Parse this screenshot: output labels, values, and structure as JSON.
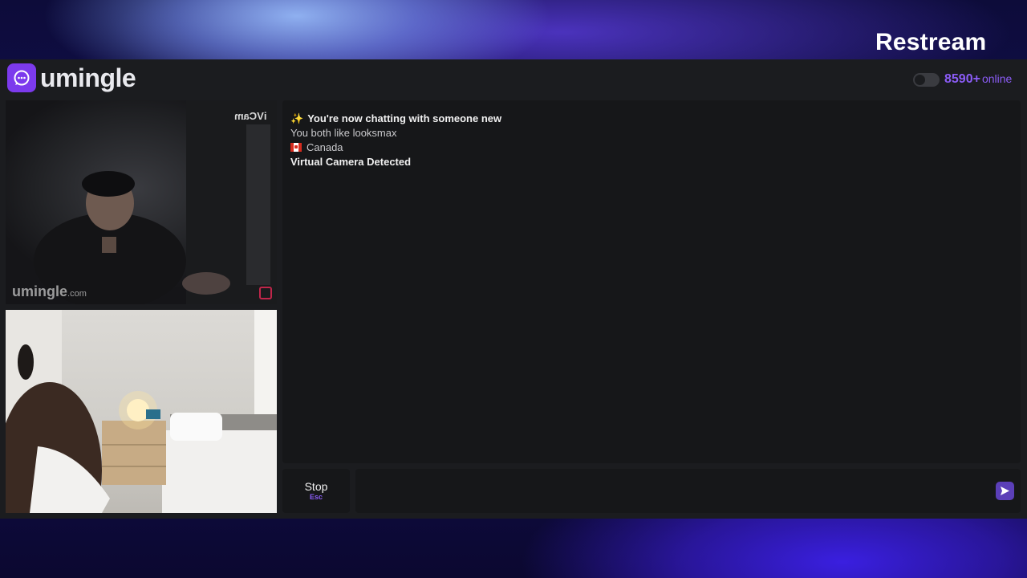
{
  "overlay": {
    "brand": "Restream"
  },
  "header": {
    "logo_text": "umingle",
    "online_count": "8590+",
    "online_label": "online",
    "theme_toggle_on": false
  },
  "remote_video": {
    "camera_badge": "iVCam",
    "watermark_main": "umingle",
    "watermark_suffix": ".com"
  },
  "chat": {
    "messages": [
      {
        "icon": "sparkle-icon",
        "text": "You're now chatting with someone new"
      },
      {
        "text": "You both like looksmax"
      },
      {
        "icon": "canada-flag-icon",
        "text": "Canada"
      },
      {
        "text": "Virtual Camera Detected"
      }
    ]
  },
  "controls": {
    "stop_label": "Stop",
    "stop_shortcut": "Esc",
    "message_value": "",
    "send_icon": "send-icon"
  },
  "colors": {
    "accent": "#8b5cf6",
    "panel": "#161719",
    "app_bg": "#1b1c1f"
  }
}
